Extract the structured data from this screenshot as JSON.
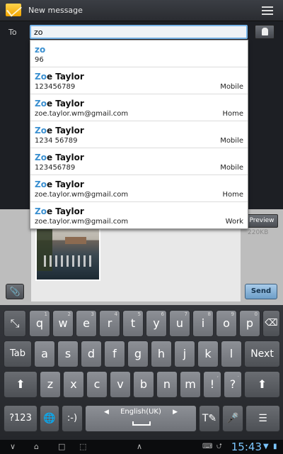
{
  "header": {
    "title": "New message",
    "app_icon": "envelope-icon",
    "menu_icon": "overflow-menu-icon"
  },
  "recipient": {
    "label": "To",
    "value": "zo"
  },
  "suggestions": [
    {
      "name_hl": "zo",
      "name_rest": "",
      "detail": "96",
      "type": ""
    },
    {
      "name_hl": "Zo",
      "name_rest": "e Taylor",
      "detail": "123456789",
      "type": "Mobile"
    },
    {
      "name_hl": "Zo",
      "name_rest": "e Taylor",
      "detail": "zoe.taylor.wm@gmail.com",
      "type": "Home"
    },
    {
      "name_hl": "Zo",
      "name_rest": "e Taylor",
      "detail": "1234 56789",
      "type": "Mobile"
    },
    {
      "name_hl": "Zo",
      "name_rest": "e Taylor",
      "detail": "123456789",
      "type": "Mobile"
    },
    {
      "name_hl": "Zo",
      "name_rest": "e Taylor",
      "detail": "zoe.taylor.wm@gmail.com",
      "type": "Home"
    },
    {
      "name_hl": "Zo",
      "name_rest": "e Taylor",
      "detail": "zoe.taylor.wm@gmail.com",
      "type": "Work"
    }
  ],
  "compose": {
    "preview_label": "Preview",
    "size": "220KB",
    "send_label": "Send"
  },
  "keyboard": {
    "row1": [
      "q",
      "w",
      "e",
      "r",
      "t",
      "y",
      "u",
      "i",
      "o",
      "p"
    ],
    "row1_sub": [
      "1",
      "2",
      "3",
      "4",
      "5",
      "6",
      "7",
      "8",
      "9",
      "0"
    ],
    "row2": [
      "a",
      "s",
      "d",
      "f",
      "g",
      "h",
      "j",
      "k",
      "l"
    ],
    "row3": [
      "z",
      "x",
      "c",
      "v",
      "b",
      "n",
      "m",
      "!",
      "?"
    ],
    "tab_label": "Tab",
    "next_label": "Next",
    "sym_label": "?123",
    "emoticon_label": ":-)",
    "language": "English(UK)",
    "comma_sub": ",",
    "period_sub": "."
  },
  "status": {
    "time": "15:43"
  }
}
